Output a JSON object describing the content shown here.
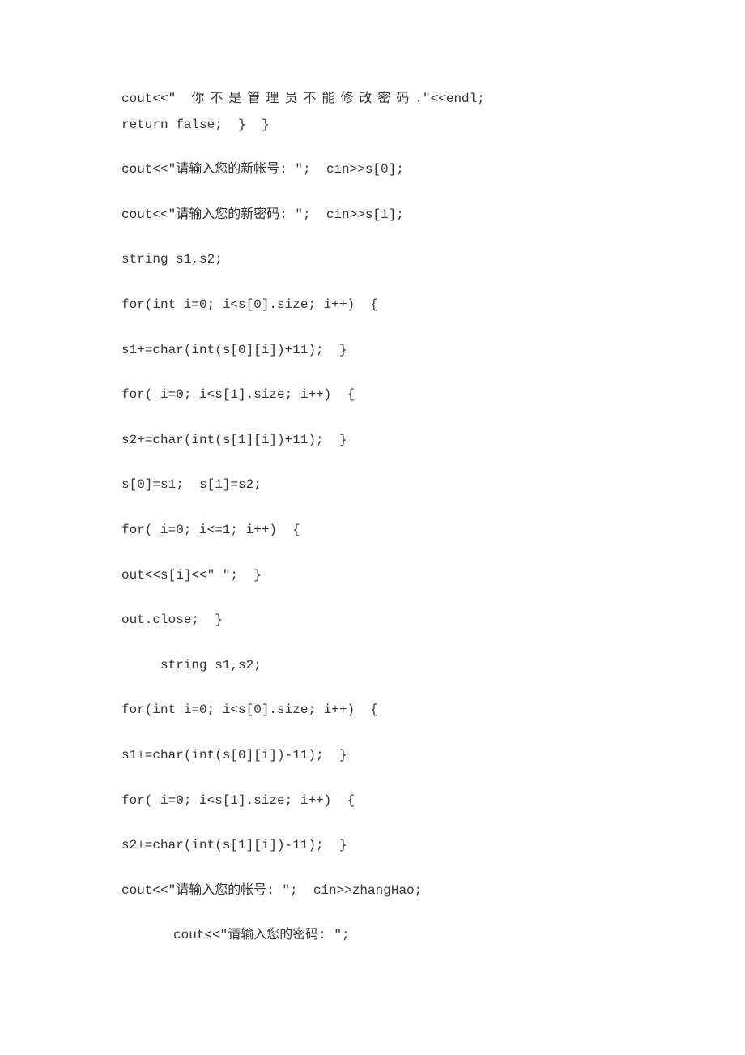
{
  "lines": [
    {
      "segments": [
        {
          "text": "cout<<\"  ",
          "cls": ""
        },
        {
          "text": "你不是管理员不能修改密码",
          "cls": "spaced-chars"
        },
        {
          "text": ".\"<<endl;",
          "cls": ""
        }
      ],
      "cls": "wrapped"
    },
    {
      "segments": [
        {
          "text": "return false;  }  }",
          "cls": ""
        }
      ]
    },
    {
      "segments": [
        {
          "text": "cout<<\"请输入您的新帐号: \";  cin>>s[0];",
          "cls": ""
        }
      ]
    },
    {
      "segments": [
        {
          "text": "cout<<\"请输入您的新密码: \";  cin>>s[1];",
          "cls": ""
        }
      ]
    },
    {
      "segments": [
        {
          "text": "string s1,s2;",
          "cls": ""
        }
      ]
    },
    {
      "segments": [
        {
          "text": "for(int i=0; i<s[0].size; i++)  {",
          "cls": ""
        }
      ]
    },
    {
      "segments": [
        {
          "text": "s1+=char(int(s[0][i])+11);  }",
          "cls": ""
        }
      ]
    },
    {
      "segments": [
        {
          "text": "for( i=0; i<s[1].size; i++)  {",
          "cls": ""
        }
      ]
    },
    {
      "segments": [
        {
          "text": "s2+=char(int(s[1][i])+11);  }",
          "cls": ""
        }
      ]
    },
    {
      "segments": [
        {
          "text": "s[0]=s1;  s[1]=s2;",
          "cls": ""
        }
      ]
    },
    {
      "segments": [
        {
          "text": "for( i=0; i<=1; i++)  {",
          "cls": ""
        }
      ]
    },
    {
      "segments": [
        {
          "text": "out<<s[i]<<\" \";  }",
          "cls": ""
        }
      ]
    },
    {
      "segments": [
        {
          "text": "out.close;  }",
          "cls": ""
        }
      ]
    },
    {
      "segments": [
        {
          "text": "string s1,s2;",
          "cls": ""
        }
      ],
      "cls": "indent1"
    },
    {
      "segments": [
        {
          "text": "for(int i=0; i<s[0].size; i++)  {",
          "cls": ""
        }
      ]
    },
    {
      "segments": [
        {
          "text": "s1+=char(int(s[0][i])-11);  }",
          "cls": ""
        }
      ]
    },
    {
      "segments": [
        {
          "text": "for( i=0; i<s[1].size; i++)  {",
          "cls": ""
        }
      ]
    },
    {
      "segments": [
        {
          "text": "s2+=char(int(s[1][i])-11);  }",
          "cls": ""
        }
      ]
    },
    {
      "segments": [
        {
          "text": "cout<<\"请输入您的帐号: \";  cin>>zhangHao;",
          "cls": ""
        }
      ]
    },
    {
      "segments": [
        {
          "text": "cout<<\"请输入您的密码: \";",
          "cls": ""
        }
      ],
      "cls": "indent2"
    }
  ]
}
